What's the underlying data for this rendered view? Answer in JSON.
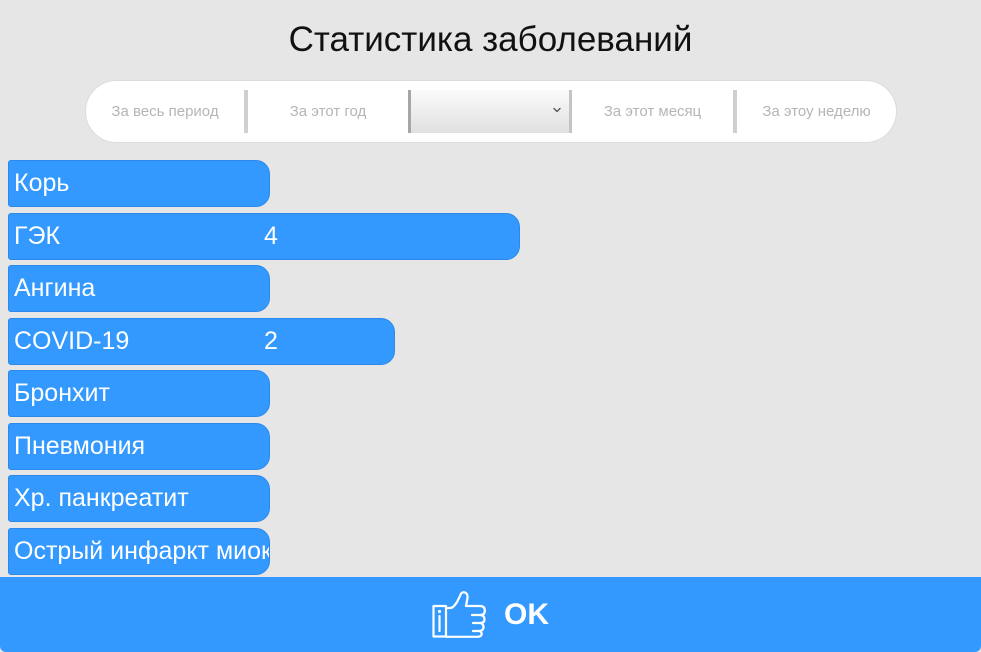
{
  "title": "Статистика заболеваний",
  "filters": {
    "tabs": [
      {
        "label": "За весь период"
      },
      {
        "label": "За этот год"
      },
      {
        "label": "За этот месяц"
      },
      {
        "label": "За этоу неделю"
      }
    ],
    "select": {
      "icon": "chevron-down-icon"
    }
  },
  "stats": {
    "items": [
      {
        "label": "Корь"
      },
      {
        "label": "ГЭК",
        "value": 4
      },
      {
        "label": "Ангина"
      },
      {
        "label": "COVID-19",
        "value": 2
      },
      {
        "label": "Бронхит"
      },
      {
        "label": "Пневмония"
      },
      {
        "label": "Хр. панкреатит"
      },
      {
        "label": "Острый инфаркт миок"
      }
    ]
  },
  "ok_button": {
    "label": "OK",
    "icon": "thumbs-up-icon"
  },
  "colors": {
    "background": "#e6e6e6",
    "accent": "#3399ff",
    "tab_text": "#b5b5b5"
  }
}
